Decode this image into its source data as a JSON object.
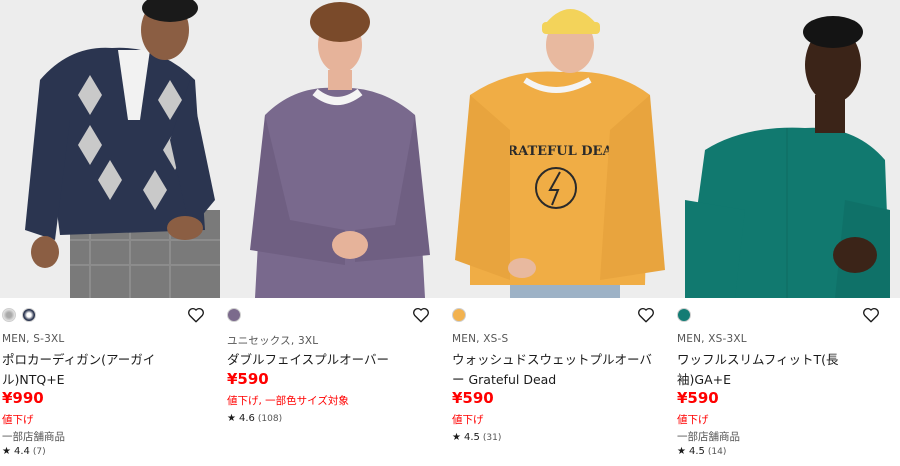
{
  "products": [
    {
      "meta": "MEN, S-3XL",
      "name": "ポロカーディガン(アーガイル)NTQ+E",
      "price": "¥990",
      "tag": "値下げ",
      "note": "一部店舗商品",
      "rating": "4.4",
      "reviews": "(7)",
      "swatches": [
        "argyle-grey-swatch",
        "argyle-navy-swatch"
      ]
    },
    {
      "meta": "ユニセックス, 3XL",
      "name": "ダブルフェイスプルオーバー",
      "price": "¥590",
      "tag": "値下げ, 一部色サイズ対象",
      "note": "",
      "rating": "4.6",
      "reviews": "(108)",
      "swatches": [
        "#7b6a8c"
      ]
    },
    {
      "meta": "MEN, XS-S",
      "name": "ウォッシュドスウェットプルオーバー Grateful Dead",
      "price": "¥590",
      "tag": "値下げ",
      "note": "",
      "rating": "4.5",
      "reviews": "(31)",
      "swatches": [
        "#f2b24f"
      ]
    },
    {
      "meta": "MEN, XS-3XL",
      "name": "ワッフルスリムフィットT(長袖)GA+E",
      "price": "¥590",
      "tag": "値下げ",
      "note": "一部店舗商品",
      "rating": "4.5",
      "reviews": "(14)",
      "swatches": [
        "#137c74"
      ]
    }
  ],
  "colors": {
    "price": "#ff0000",
    "card1_sweater": "#2b3550",
    "card2_sweater": "#79698d",
    "card3_sweater": "#f0ad45",
    "card4_shirt": "#11796f"
  },
  "icons": {
    "favorite": "heart-outline-icon",
    "star": "star-icon"
  },
  "prints": {
    "card3_logo": "GRATEFUL DEAD"
  }
}
